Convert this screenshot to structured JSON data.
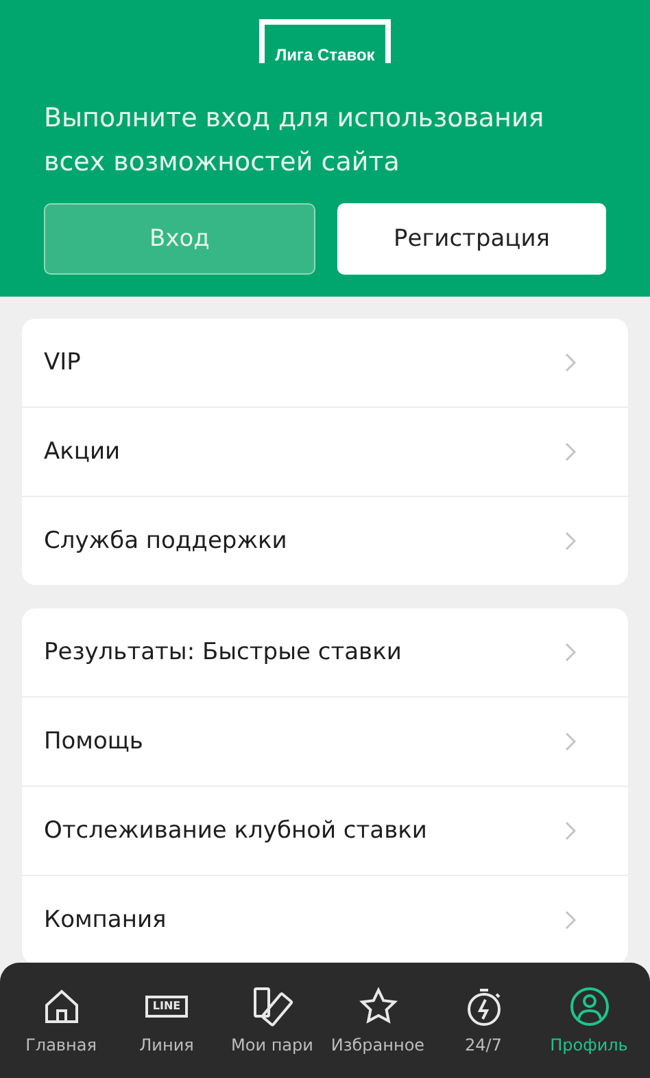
{
  "header": {
    "logo": "Лига Ставок",
    "message": "Выполните вход для использования всех возможностей сайта",
    "buttons": [
      {
        "label": "Вход",
        "kind": "primary"
      },
      {
        "label": "Регистрация",
        "kind": "secondary"
      }
    ]
  },
  "menu_groups": [
    {
      "items": [
        "VIP",
        "Акции",
        "Служба поддержки"
      ]
    },
    {
      "items": [
        "Результаты: Быстрые ставки",
        "Помощь",
        "Отслеживание клубной ставки",
        "Компания"
      ]
    }
  ],
  "nav": [
    {
      "label": "Главная",
      "kind": "home",
      "selected": false
    },
    {
      "label": "Линия",
      "kind": "line",
      "icon_text": "LINE",
      "selected": false
    },
    {
      "label": "Мои пари",
      "kind": "bets",
      "selected": false
    },
    {
      "label": "Избранное",
      "kind": "favorites",
      "selected": false
    },
    {
      "label": "24/7",
      "kind": "live",
      "selected": false
    },
    {
      "label": "Профиль",
      "kind": "profile",
      "selected": true
    }
  ]
}
